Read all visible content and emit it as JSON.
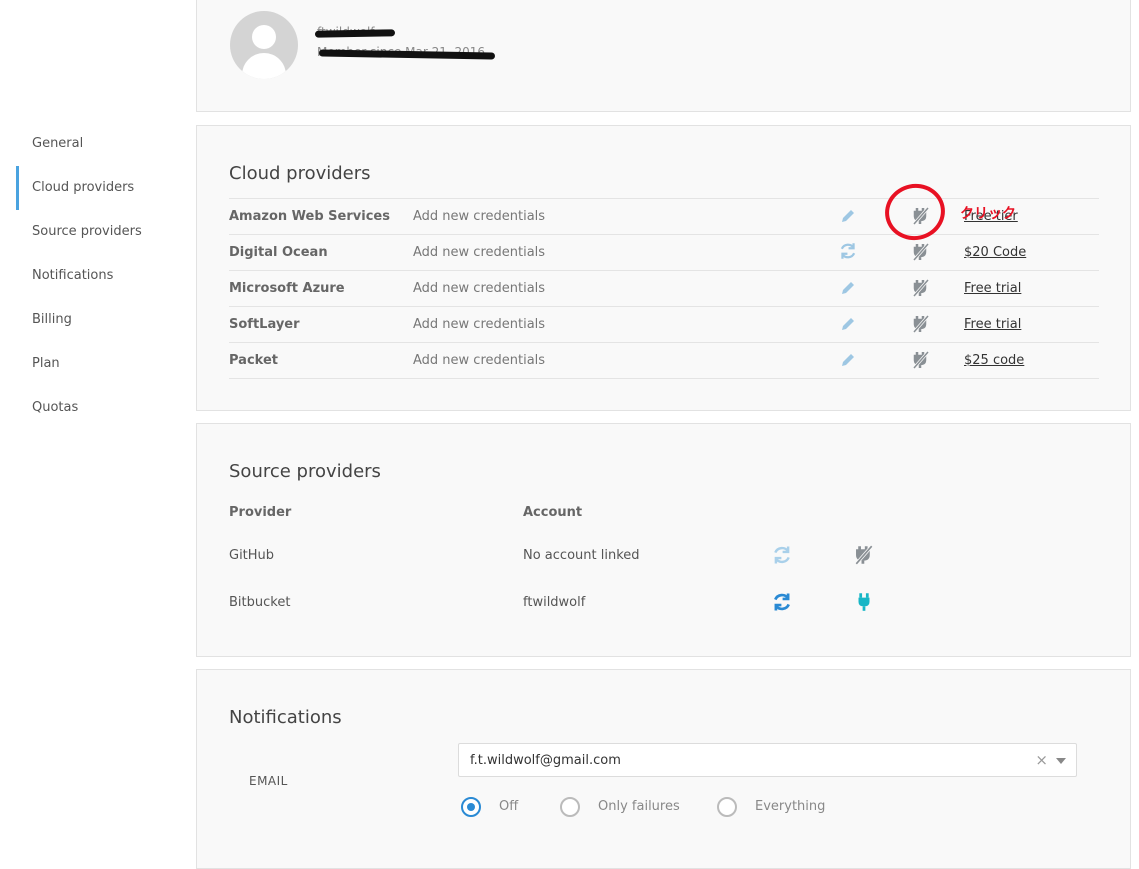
{
  "sidebar": {
    "items": [
      {
        "label": "General"
      },
      {
        "label": "Cloud providers",
        "active": true
      },
      {
        "label": "Source providers"
      },
      {
        "label": "Notifications"
      },
      {
        "label": "Billing"
      },
      {
        "label": "Plan"
      },
      {
        "label": "Quotas"
      }
    ]
  },
  "profile": {
    "name": "ftwildwolf",
    "member_since": "Member since Mar 21, 2016"
  },
  "cloud": {
    "title": "Cloud providers",
    "rows": [
      {
        "name": "Amazon Web Services",
        "credentials": "Add new credentials",
        "promo": "Free tier",
        "action_icon": "pencil-icon"
      },
      {
        "name": "Digital Ocean",
        "credentials": "Add new credentials",
        "promo": "$20 Code",
        "action_icon": "sync-icon"
      },
      {
        "name": "Microsoft Azure",
        "credentials": "Add new credentials",
        "promo": "Free trial",
        "action_icon": "pencil-icon"
      },
      {
        "name": "SoftLayer",
        "credentials": "Add new credentials",
        "promo": "Free trial",
        "action_icon": "pencil-icon"
      },
      {
        "name": "Packet",
        "credentials": "Add new credentials",
        "promo": "$25 code",
        "action_icon": "pencil-icon"
      }
    ]
  },
  "source": {
    "title": "Source providers",
    "col_provider": "Provider",
    "col_account": "Account",
    "rows": [
      {
        "provider": "GitHub",
        "account": "No account linked",
        "connected": false
      },
      {
        "provider": "Bitbucket",
        "account": "ftwildwolf",
        "connected": true
      }
    ]
  },
  "notifications": {
    "title": "Notifications",
    "email_label": "EMAIL",
    "email_value": "f.t.wildwolf@gmail.com",
    "clear_symbol": "×",
    "options": [
      {
        "label": "Off",
        "checked": true
      },
      {
        "label": "Only failures",
        "checked": false
      },
      {
        "label": "Everything",
        "checked": false
      }
    ]
  },
  "annotation": {
    "text": "クリック",
    "color": "#e81123"
  },
  "colors": {
    "accent": "#2a8ad4",
    "sidebar_active": "#4aa3e0",
    "connected_plug": "#17b6c6",
    "icon_gray": "#8a9095"
  }
}
